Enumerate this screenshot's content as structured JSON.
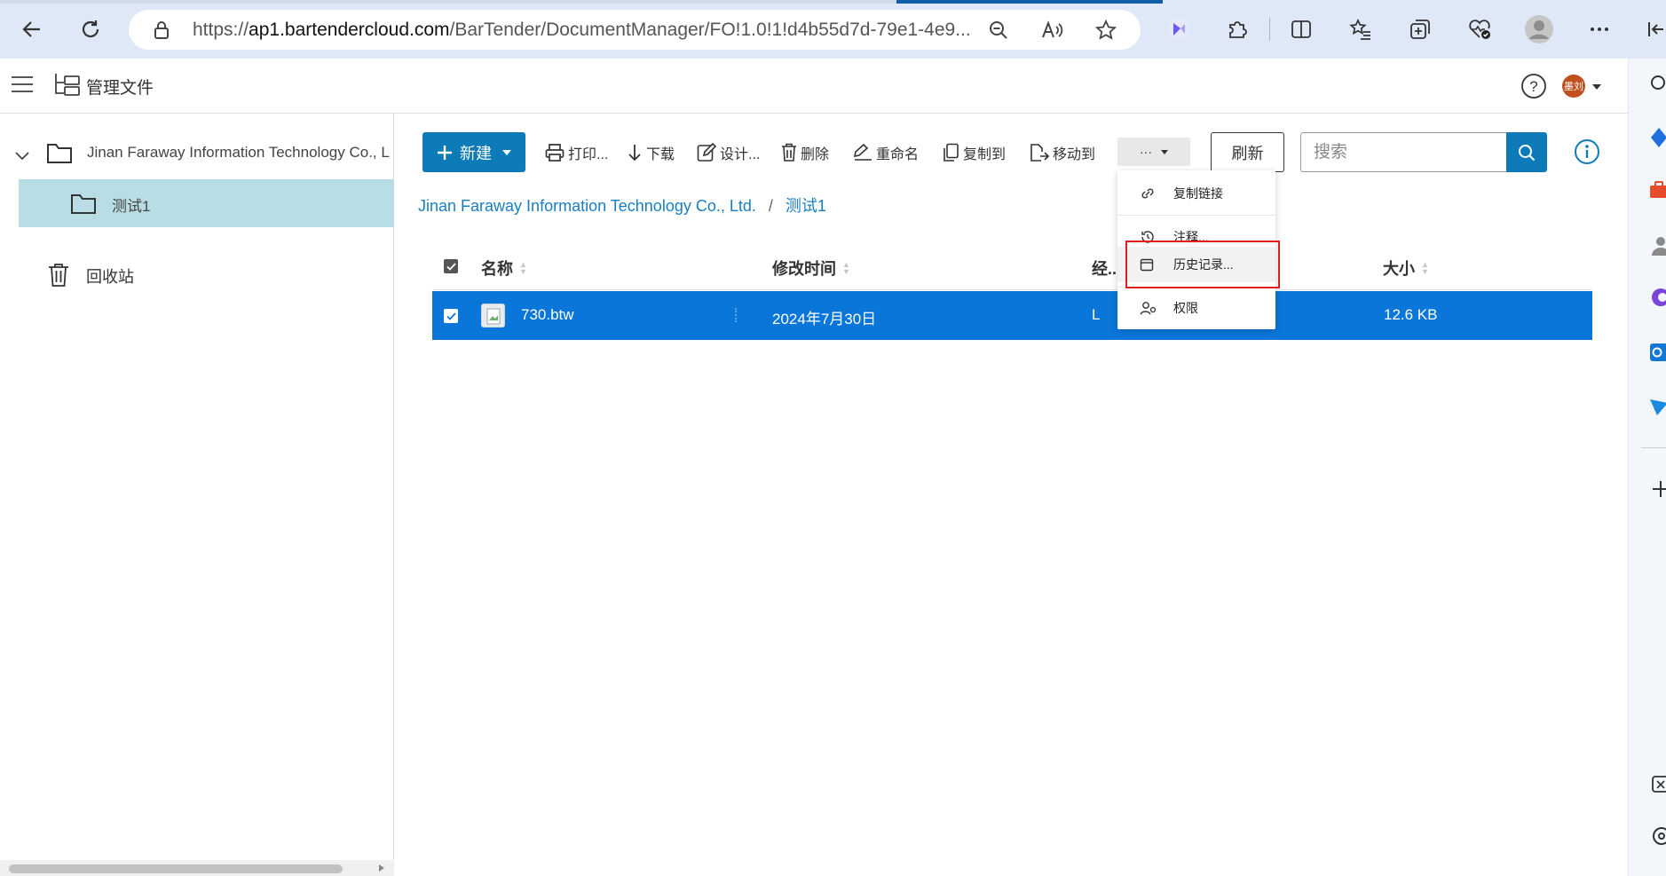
{
  "browser": {
    "url_prefix": "https://",
    "url_host": "ap1.bartendercloud.com",
    "url_path": "/BarTender/DocumentManager/FO!1.0!1!d4b55d7d-79e1-4e9...",
    "tab_accent_color": "#0f5fa8"
  },
  "app": {
    "title": "管理文件",
    "avatar_text": "墨刘",
    "avatar_color": "#c0501e"
  },
  "tree": {
    "root_label": "Jinan Faraway Information Technology Co., L",
    "child_label": "测试1",
    "recycle_label": "回收站"
  },
  "toolbar": {
    "new_label": "新建",
    "print_label": "打印...",
    "download_label": "下载",
    "design_label": "设计...",
    "delete_label": "删除",
    "rename_label": "重命名",
    "copy_to_label": "复制到",
    "move_to_label": "移动到",
    "more_label": "···",
    "refresh_label": "刷新",
    "search_placeholder": "搜索"
  },
  "breadcrumb": {
    "root": "Jinan Faraway Information Technology Co., Ltd.",
    "separator": "/",
    "current": "测试1"
  },
  "table": {
    "columns": [
      "名称",
      "修改时间",
      "经..",
      "大小"
    ],
    "rows": [
      {
        "name": "730.btw",
        "modified": "2024年7月30日",
        "owner": "L",
        "size": "12.6 KB"
      }
    ]
  },
  "more_menu": {
    "items": [
      "复制链接",
      "注释...",
      "历史记录...",
      "权限"
    ]
  },
  "colors": {
    "primary": "#0e7bb9",
    "selected_row": "#0a76da",
    "tree_selected": "#b9dde4",
    "highlight_box": "#e02020",
    "breadcrumb_link": "#1a7fc0"
  }
}
